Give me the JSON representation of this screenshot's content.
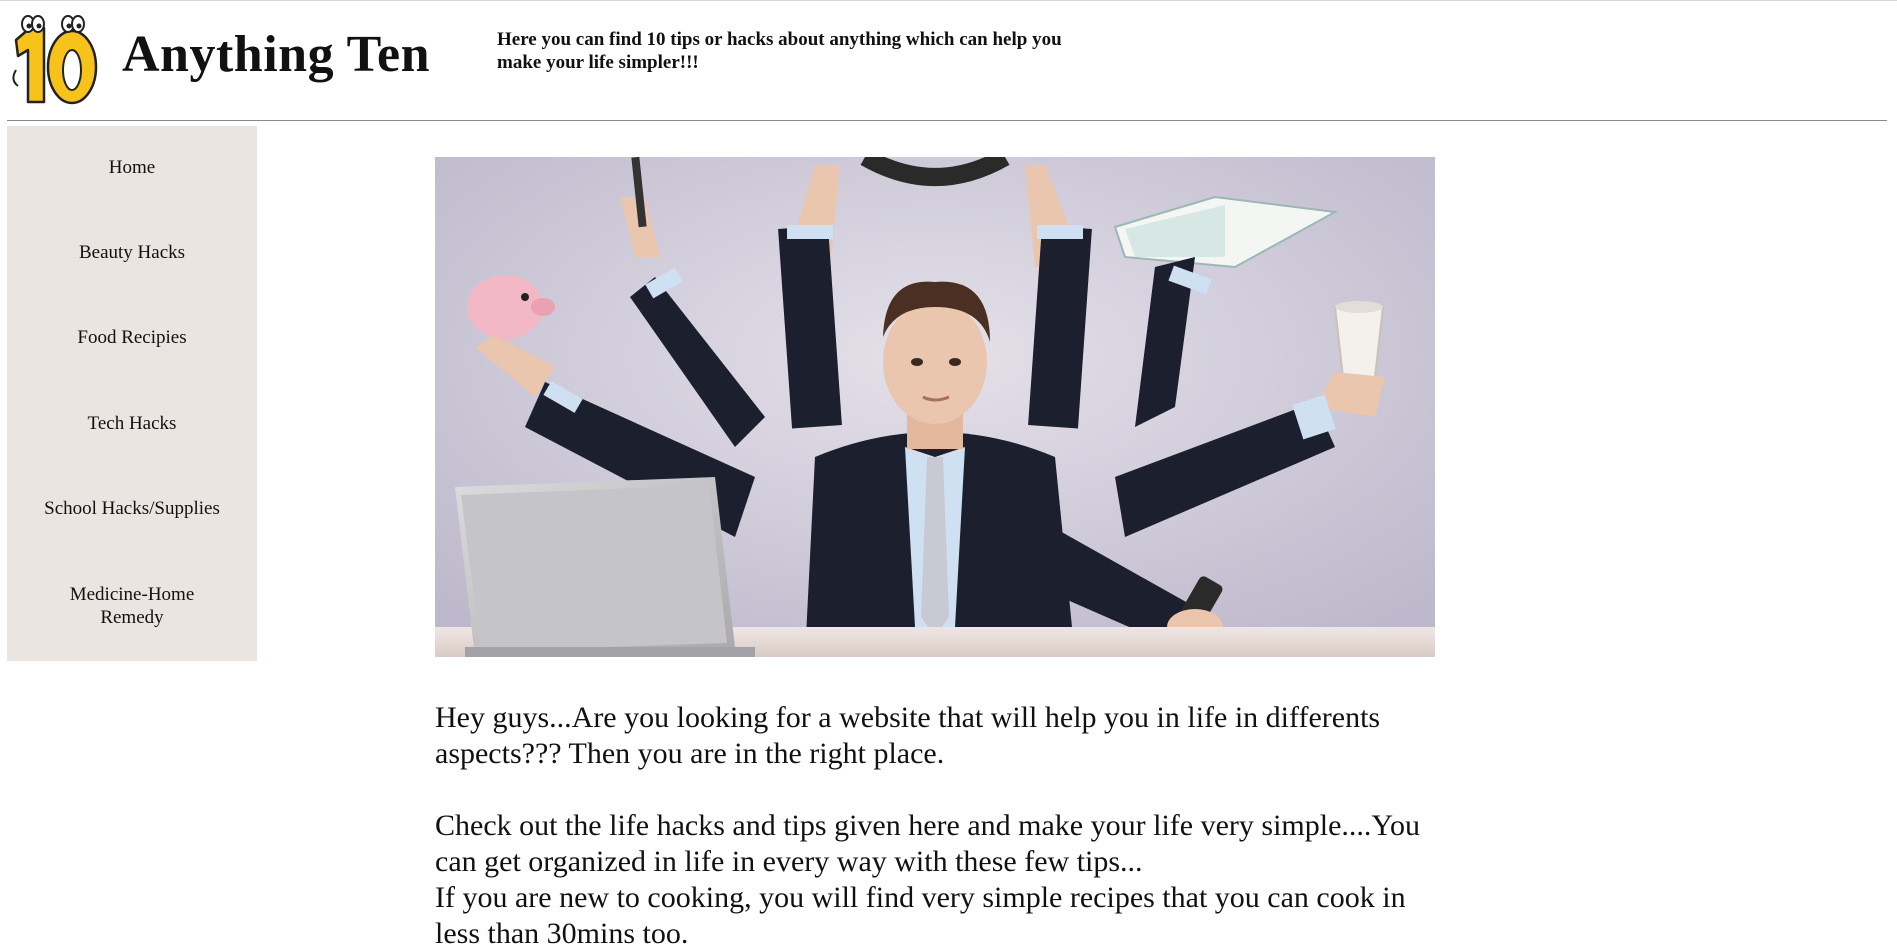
{
  "header": {
    "logo_text": "10",
    "site_title": "Anything Ten",
    "tagline": "Here you can find 10 tips or hacks about anything which can help you make your life simpler!!!"
  },
  "sidebar": {
    "items": [
      {
        "label": "Home"
      },
      {
        "label": "Beauty Hacks"
      },
      {
        "label": "Food Recipies"
      },
      {
        "label": "Tech Hacks"
      },
      {
        "label": "School Hacks/Supplies"
      },
      {
        "label": "Medicine-Home Remedy"
      }
    ]
  },
  "main": {
    "paragraph_1": "Hey guys...Are you looking for a website that will help you in life in differents aspects??? Then you are in the right place.",
    "paragraph_2": "Check out the life hacks and tips given here and make your life very simple....You can get organized in life in every way with these few tips...",
    "paragraph_3": "If you are new to cooking, you will find very simple recipes that you can cook in less than 30mins too."
  },
  "colors": {
    "sidebar_bg": "#ebe4e1",
    "logo_yellow": "#f7c31a",
    "hero_bg": "#cfcbd9",
    "suit": "#1b1f2e"
  }
}
